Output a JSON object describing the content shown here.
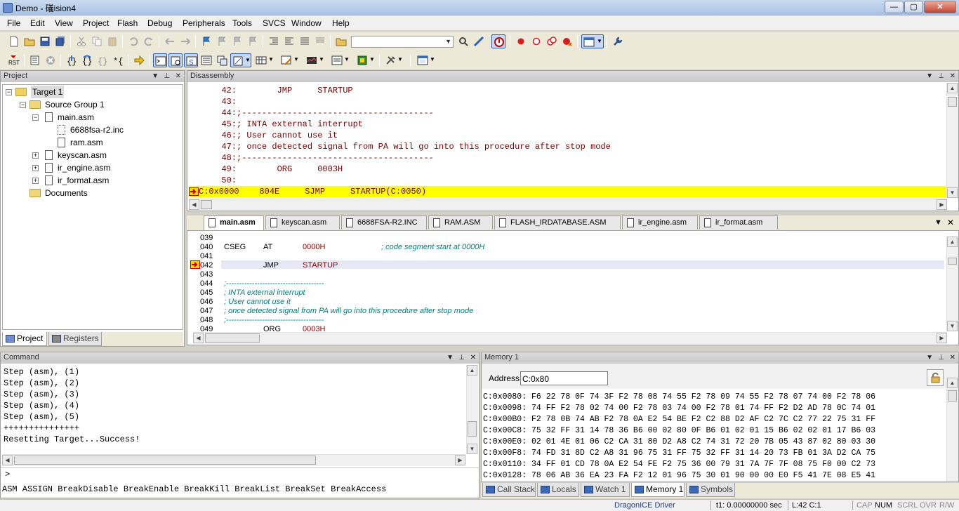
{
  "window": {
    "title": "Demo - 礒ision4",
    "minimize": "—",
    "maximize": "▢",
    "close": "✕"
  },
  "menu": [
    "File",
    "Edit",
    "View",
    "Project",
    "Flash",
    "Debug",
    "Peripherals",
    "Tools",
    "SVCS",
    "Window",
    "Help"
  ],
  "project_pane": {
    "title": "Project",
    "tree": [
      {
        "label": "Target 1",
        "level": 0,
        "kind": "target",
        "expander": "−"
      },
      {
        "label": "Source Group 1",
        "level": 1,
        "kind": "folder",
        "expander": "−"
      },
      {
        "label": "main.asm",
        "level": 2,
        "kind": "file",
        "expander": "−"
      },
      {
        "label": "6688fsa-r2.inc",
        "level": 3,
        "kind": "file",
        "expander": ""
      },
      {
        "label": "ram.asm",
        "level": 3,
        "kind": "file",
        "expander": ""
      },
      {
        "label": "keyscan.asm",
        "level": 2,
        "kind": "file",
        "expander": "+"
      },
      {
        "label": "ir_engine.asm",
        "level": 2,
        "kind": "file",
        "expander": "+"
      },
      {
        "label": "ir_format.asm",
        "level": 2,
        "kind": "file",
        "expander": "+"
      },
      {
        "label": "Documents",
        "level": 1,
        "kind": "folder",
        "expander": ""
      }
    ],
    "tabs": [
      "Project",
      "Registers"
    ]
  },
  "disassembly": {
    "title": "Disassembly",
    "lines": [
      {
        "num": "42:",
        "text": "        JMP     STARTUP"
      },
      {
        "num": "43:",
        "text": ""
      },
      {
        "num": "44:",
        "text": ";--------------------------------------"
      },
      {
        "num": "45:",
        "text": "; INTA external interrupt"
      },
      {
        "num": "46:",
        "text": "; User cannot use it"
      },
      {
        "num": "47:",
        "text": "; once detected signal from PA will go into this procedure after stop mode"
      },
      {
        "num": "48:",
        "text": ";--------------------------------------"
      },
      {
        "num": "49:",
        "text": "        ORG     0003H"
      },
      {
        "num": "50:",
        "text": ""
      }
    ],
    "current": "C:0x0000    804E     SJMP     STARTUP(C:0050)"
  },
  "editor": {
    "tabs": [
      "main.asm",
      "keyscan.asm",
      "6688FSA-R2.INC",
      "RAM.ASM",
      "FLASH_IRDATABASE.ASM",
      "ir_engine.asm",
      "ir_format.asm"
    ],
    "lines": [
      {
        "num": "039",
        "code": "",
        "op": "",
        "arg": "",
        "comment": ""
      },
      {
        "num": "040",
        "code": "CSEG",
        "op": "AT",
        "arg": "0000H",
        "comment": "; code segment start at 0000H"
      },
      {
        "num": "041",
        "code": "",
        "op": "",
        "arg": "",
        "comment": ""
      },
      {
        "num": "042",
        "code": "",
        "op": "JMP",
        "arg": "STARTUP",
        "comment": ""
      },
      {
        "num": "043",
        "code": "",
        "op": "",
        "arg": "",
        "comment": ""
      },
      {
        "num": "044",
        "code": "",
        "op": "",
        "arg": "",
        "comment": ";--------------------------------------"
      },
      {
        "num": "045",
        "code": "",
        "op": "",
        "arg": "",
        "comment": "; INTA external interrupt"
      },
      {
        "num": "046",
        "code": "",
        "op": "",
        "arg": "",
        "comment": "; User cannot use it"
      },
      {
        "num": "047",
        "code": "",
        "op": "",
        "arg": "",
        "comment": "; once detected signal from PA will go into this procedure after stop mode"
      },
      {
        "num": "048",
        "code": "",
        "op": "",
        "arg": "",
        "comment": ";--------------------------------------"
      },
      {
        "num": "049",
        "code": "",
        "op": "ORG",
        "arg": "0003H",
        "comment": ""
      }
    ]
  },
  "command": {
    "title": "Command",
    "lines": [
      "Step (asm), (1)",
      "Step (asm), (2)",
      "Step (asm), (3)",
      "Step (asm), (4)",
      "Step (asm), (5)",
      "+++++++++++++++",
      "Resetting Target...Success!"
    ],
    "prompt": ">",
    "hint": "ASM ASSIGN BreakDisable BreakEnable BreakKill BreakList BreakSet BreakAccess"
  },
  "memory": {
    "title": "Memory 1",
    "address_label": "Address:",
    "address_value": "C:0x80",
    "lines": [
      "C:0x0080: F6 22 78 0F 74 3F F2 78 08 74 55 F2 78 09 74 55 F2 78 07 74 00 F2 78 06",
      "C:0x0098: 74 FF F2 78 02 74 00 F2 78 03 74 00 F2 78 01 74 FF F2 D2 AD 78 0C 74 01",
      "C:0x00B0: F2 78 0B 74 AB F2 78 0A E2 54 BE F2 C2 88 D2 AF C2 7C C2 77 22 75 31 FF",
      "C:0x00C8: 75 32 FF 31 14 78 36 B6 00 02 80 0F B6 01 02 01 15 B6 02 02 01 17 B6 03",
      "C:0x00E0: 02 01 4E 01 06 C2 CA 31 80 D2 A8 C2 74 31 72 20 7B 05 43 87 02 80 03 30",
      "C:0x00F8: 74 FD 31 8D C2 A8 31 96 75 31 FF 75 32 FF 31 14 20 73 FB 01 3A D2 CA 75",
      "C:0x0110: 34 FF 01 CD 78 0A E2 54 FE F2 75 36 00 79 31 7A 7F 7F 08 75 F0 00 C2 73",
      "C:0x0128: 78 06 AB 36 EA 23 FA F2 12 01 96 75 30 01 90 00 00 E0 F5 41 7E 08 E5 41"
    ]
  },
  "bottom_tabs": [
    "Call Stack",
    "Locals",
    "Watch 1",
    "Memory 1",
    "Symbols"
  ],
  "status": {
    "driver": "DragonICE Driver",
    "time": "t1: 0.00000000 sec",
    "pos": "L:42 C:1",
    "caps": "CAP",
    "num": "NUM",
    "scrl": "SCRL",
    "ovr": "OVR",
    "rw": "R/W"
  },
  "colors": {
    "highlight": "#ffff00",
    "current_line": "#e8e8f4",
    "arrow": "#c80000",
    "comment": "#008080"
  }
}
